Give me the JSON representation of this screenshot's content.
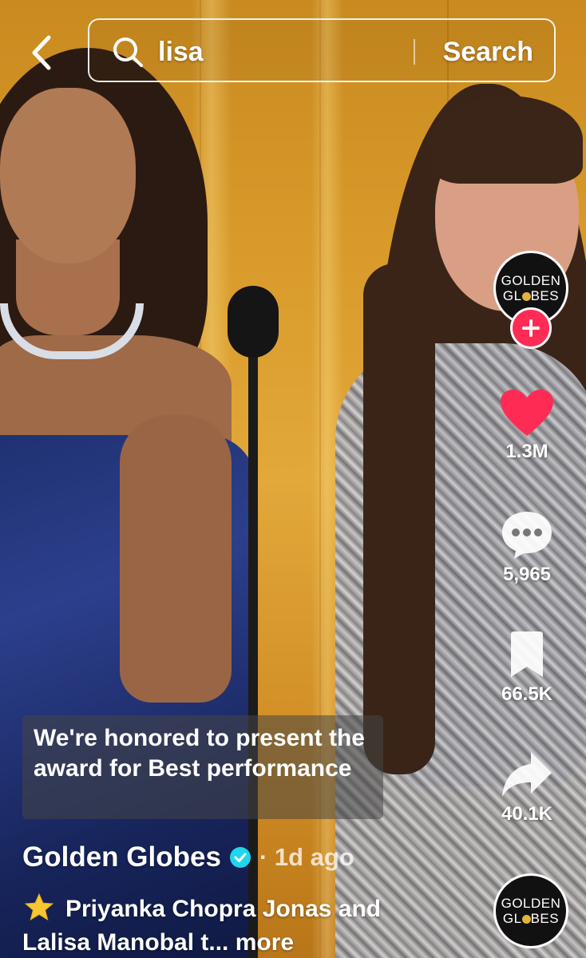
{
  "search": {
    "query": "lisa",
    "submit_label": "Search"
  },
  "actions": {
    "likes": "1.3M",
    "comments": "5,965",
    "bookmarks": "66.5K",
    "shares": "40.1K"
  },
  "avatar": {
    "line1": "GOLDEN",
    "line2_a": "GL",
    "line2_b": "BES"
  },
  "video": {
    "caption_overlay": "We're honored to present the award for Best performance",
    "author": "Golden Globes",
    "time": "· 1d ago",
    "description": "Priyanka Chopra Jonas and Lalisa Manobal t...",
    "more_label": "more"
  },
  "colors": {
    "like_red": "#fe2c55",
    "verified_blue": "#20d5ec",
    "text": "#ffffff"
  },
  "icons": [
    "back-chevron-icon",
    "search-icon",
    "plus-icon",
    "heart-icon",
    "comment-icon",
    "bookmark-icon",
    "share-icon",
    "verified-icon",
    "star-icon"
  ]
}
